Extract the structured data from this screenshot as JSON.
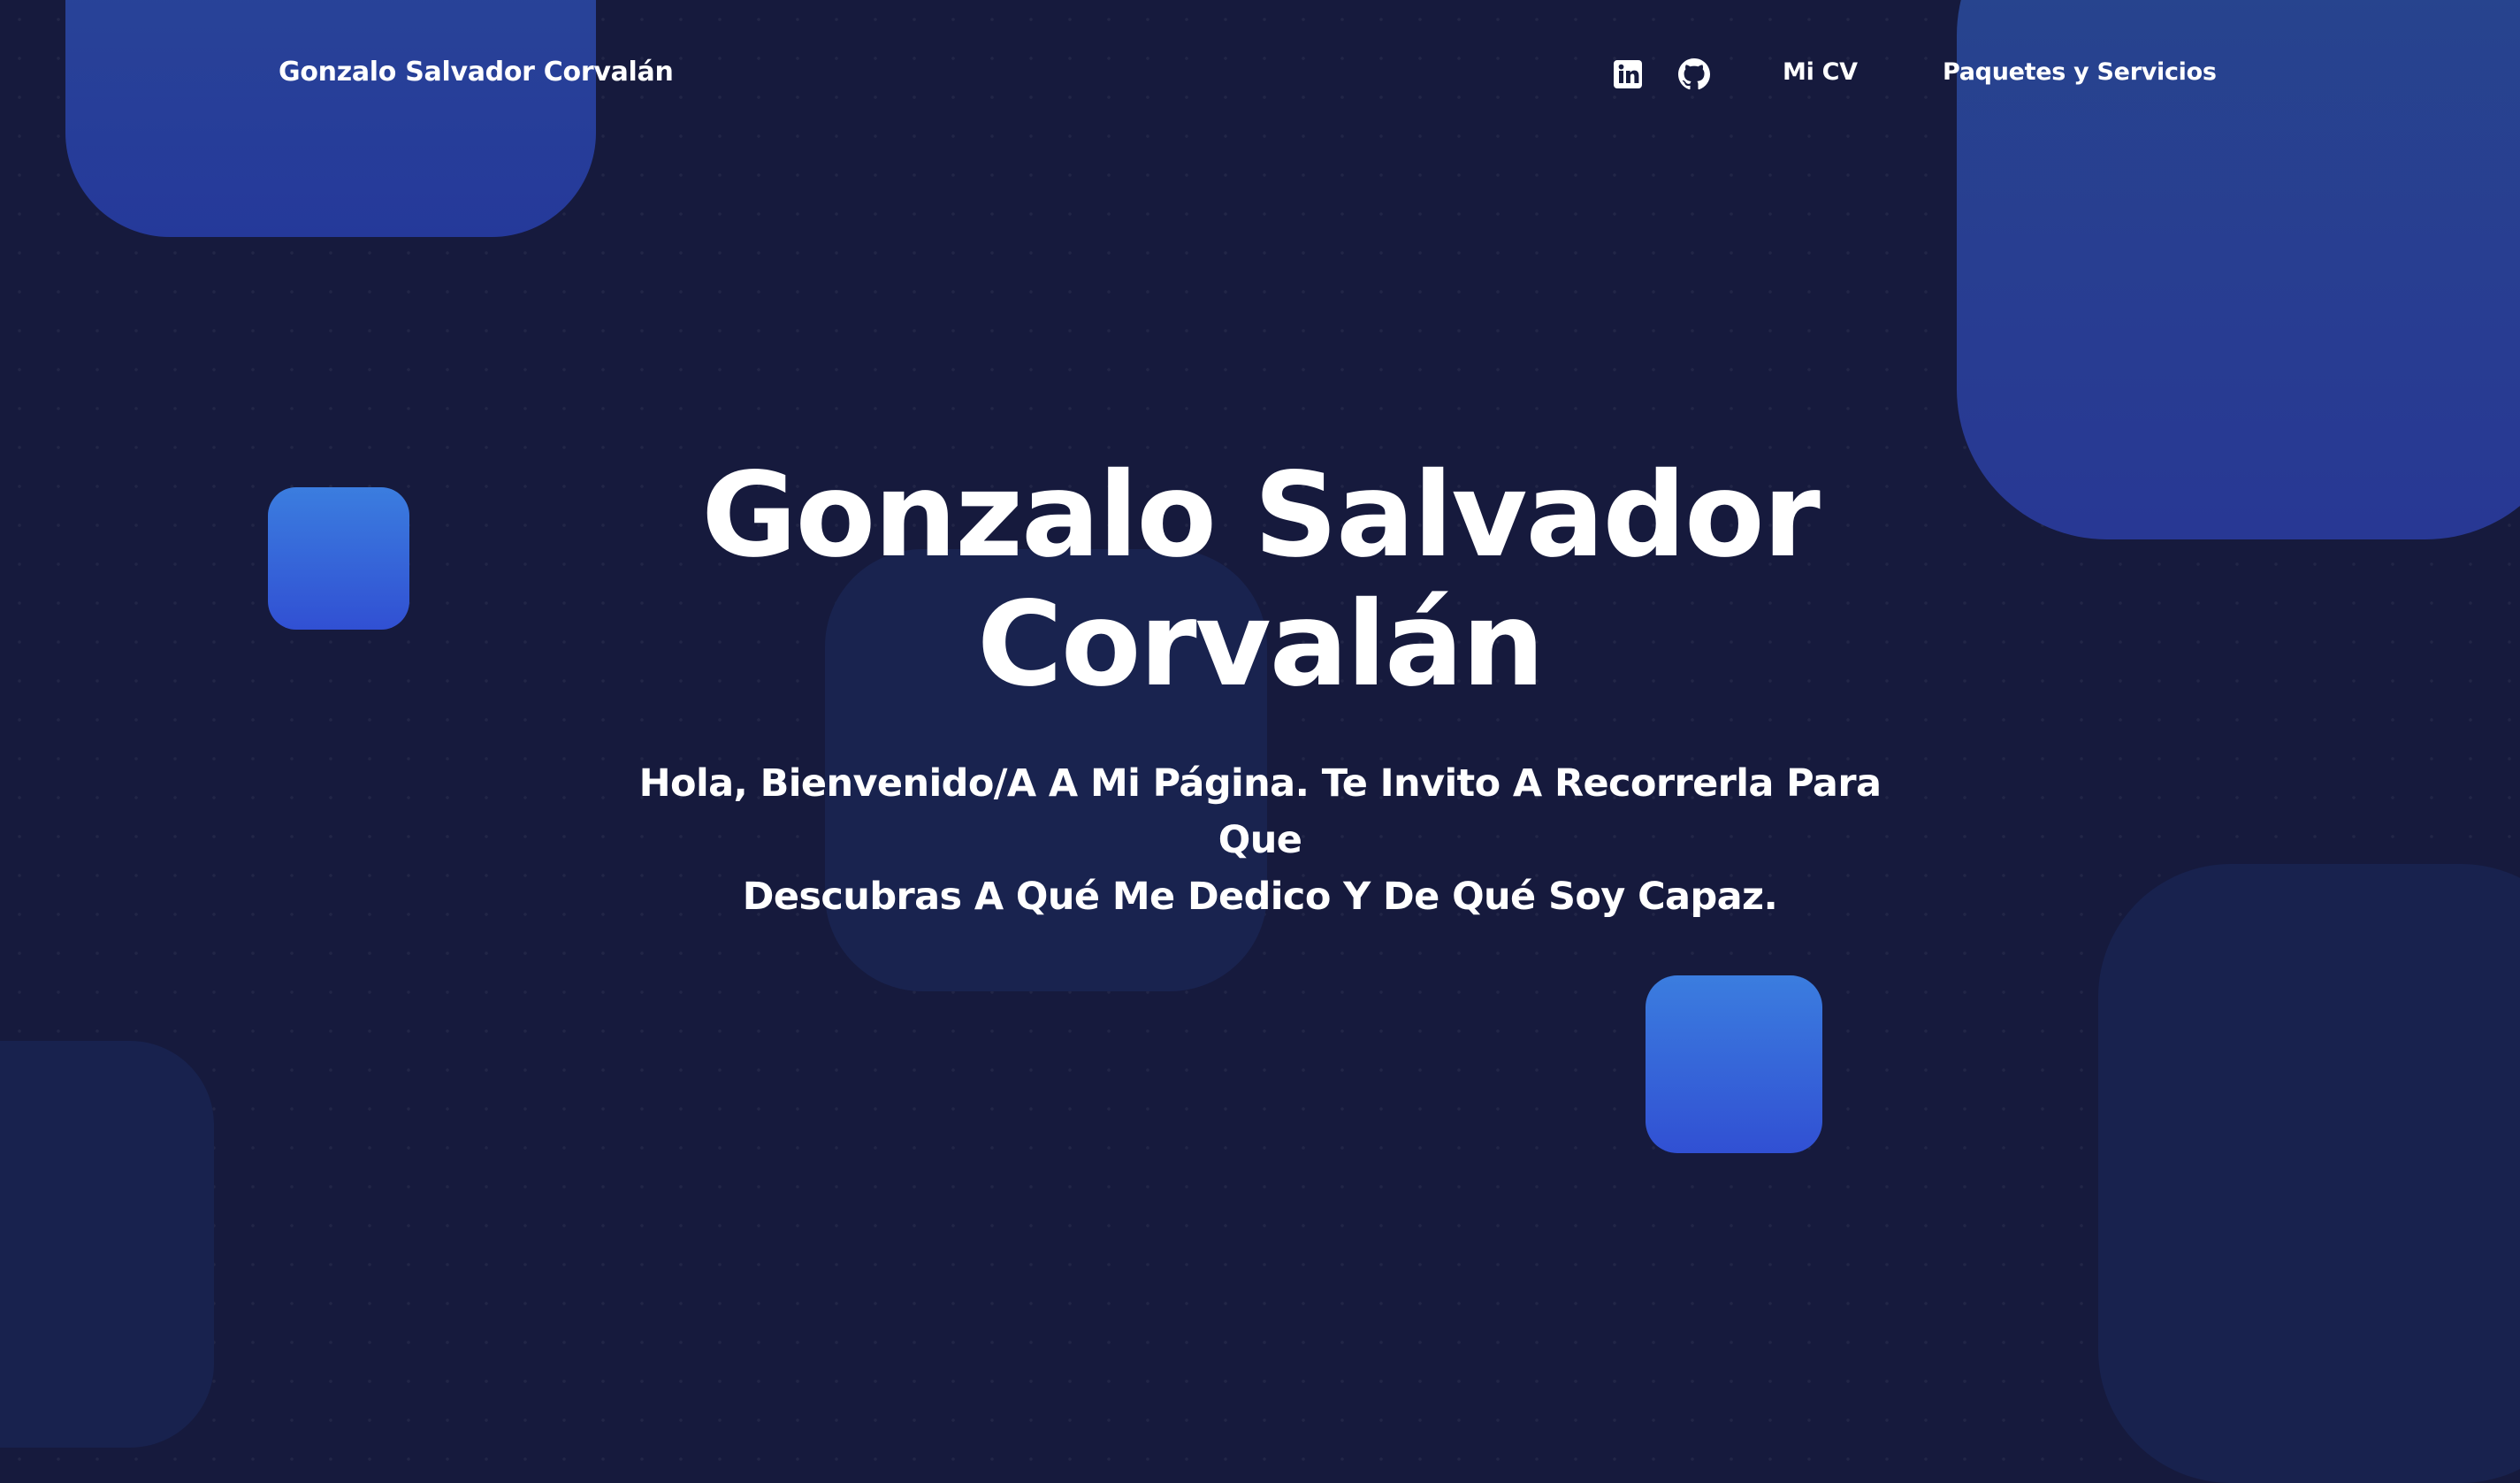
{
  "navbar": {
    "brand": "Gonzalo Salvador Corvalán",
    "icons": [
      {
        "name": "linkedin-icon"
      },
      {
        "name": "github-icon"
      }
    ],
    "links": [
      {
        "label": "Mi CV"
      },
      {
        "label": "Paquetes y Servicios"
      }
    ]
  },
  "hero": {
    "title_line1": "Gonzalo Salvador",
    "title_line2": "Corvalán",
    "subtitle_line1": "Hola, Bienvenido/A A Mi Página. Te Invito A Recorrerla Para Que",
    "subtitle_line2": "Descubras A Qué Me Dedico Y De Qué Soy Capaz."
  },
  "colors": {
    "background": "#161a3d",
    "accent_blue_top": "#3b7ddf",
    "accent_blue_bottom": "#3150d3",
    "text": "#ffffff"
  }
}
